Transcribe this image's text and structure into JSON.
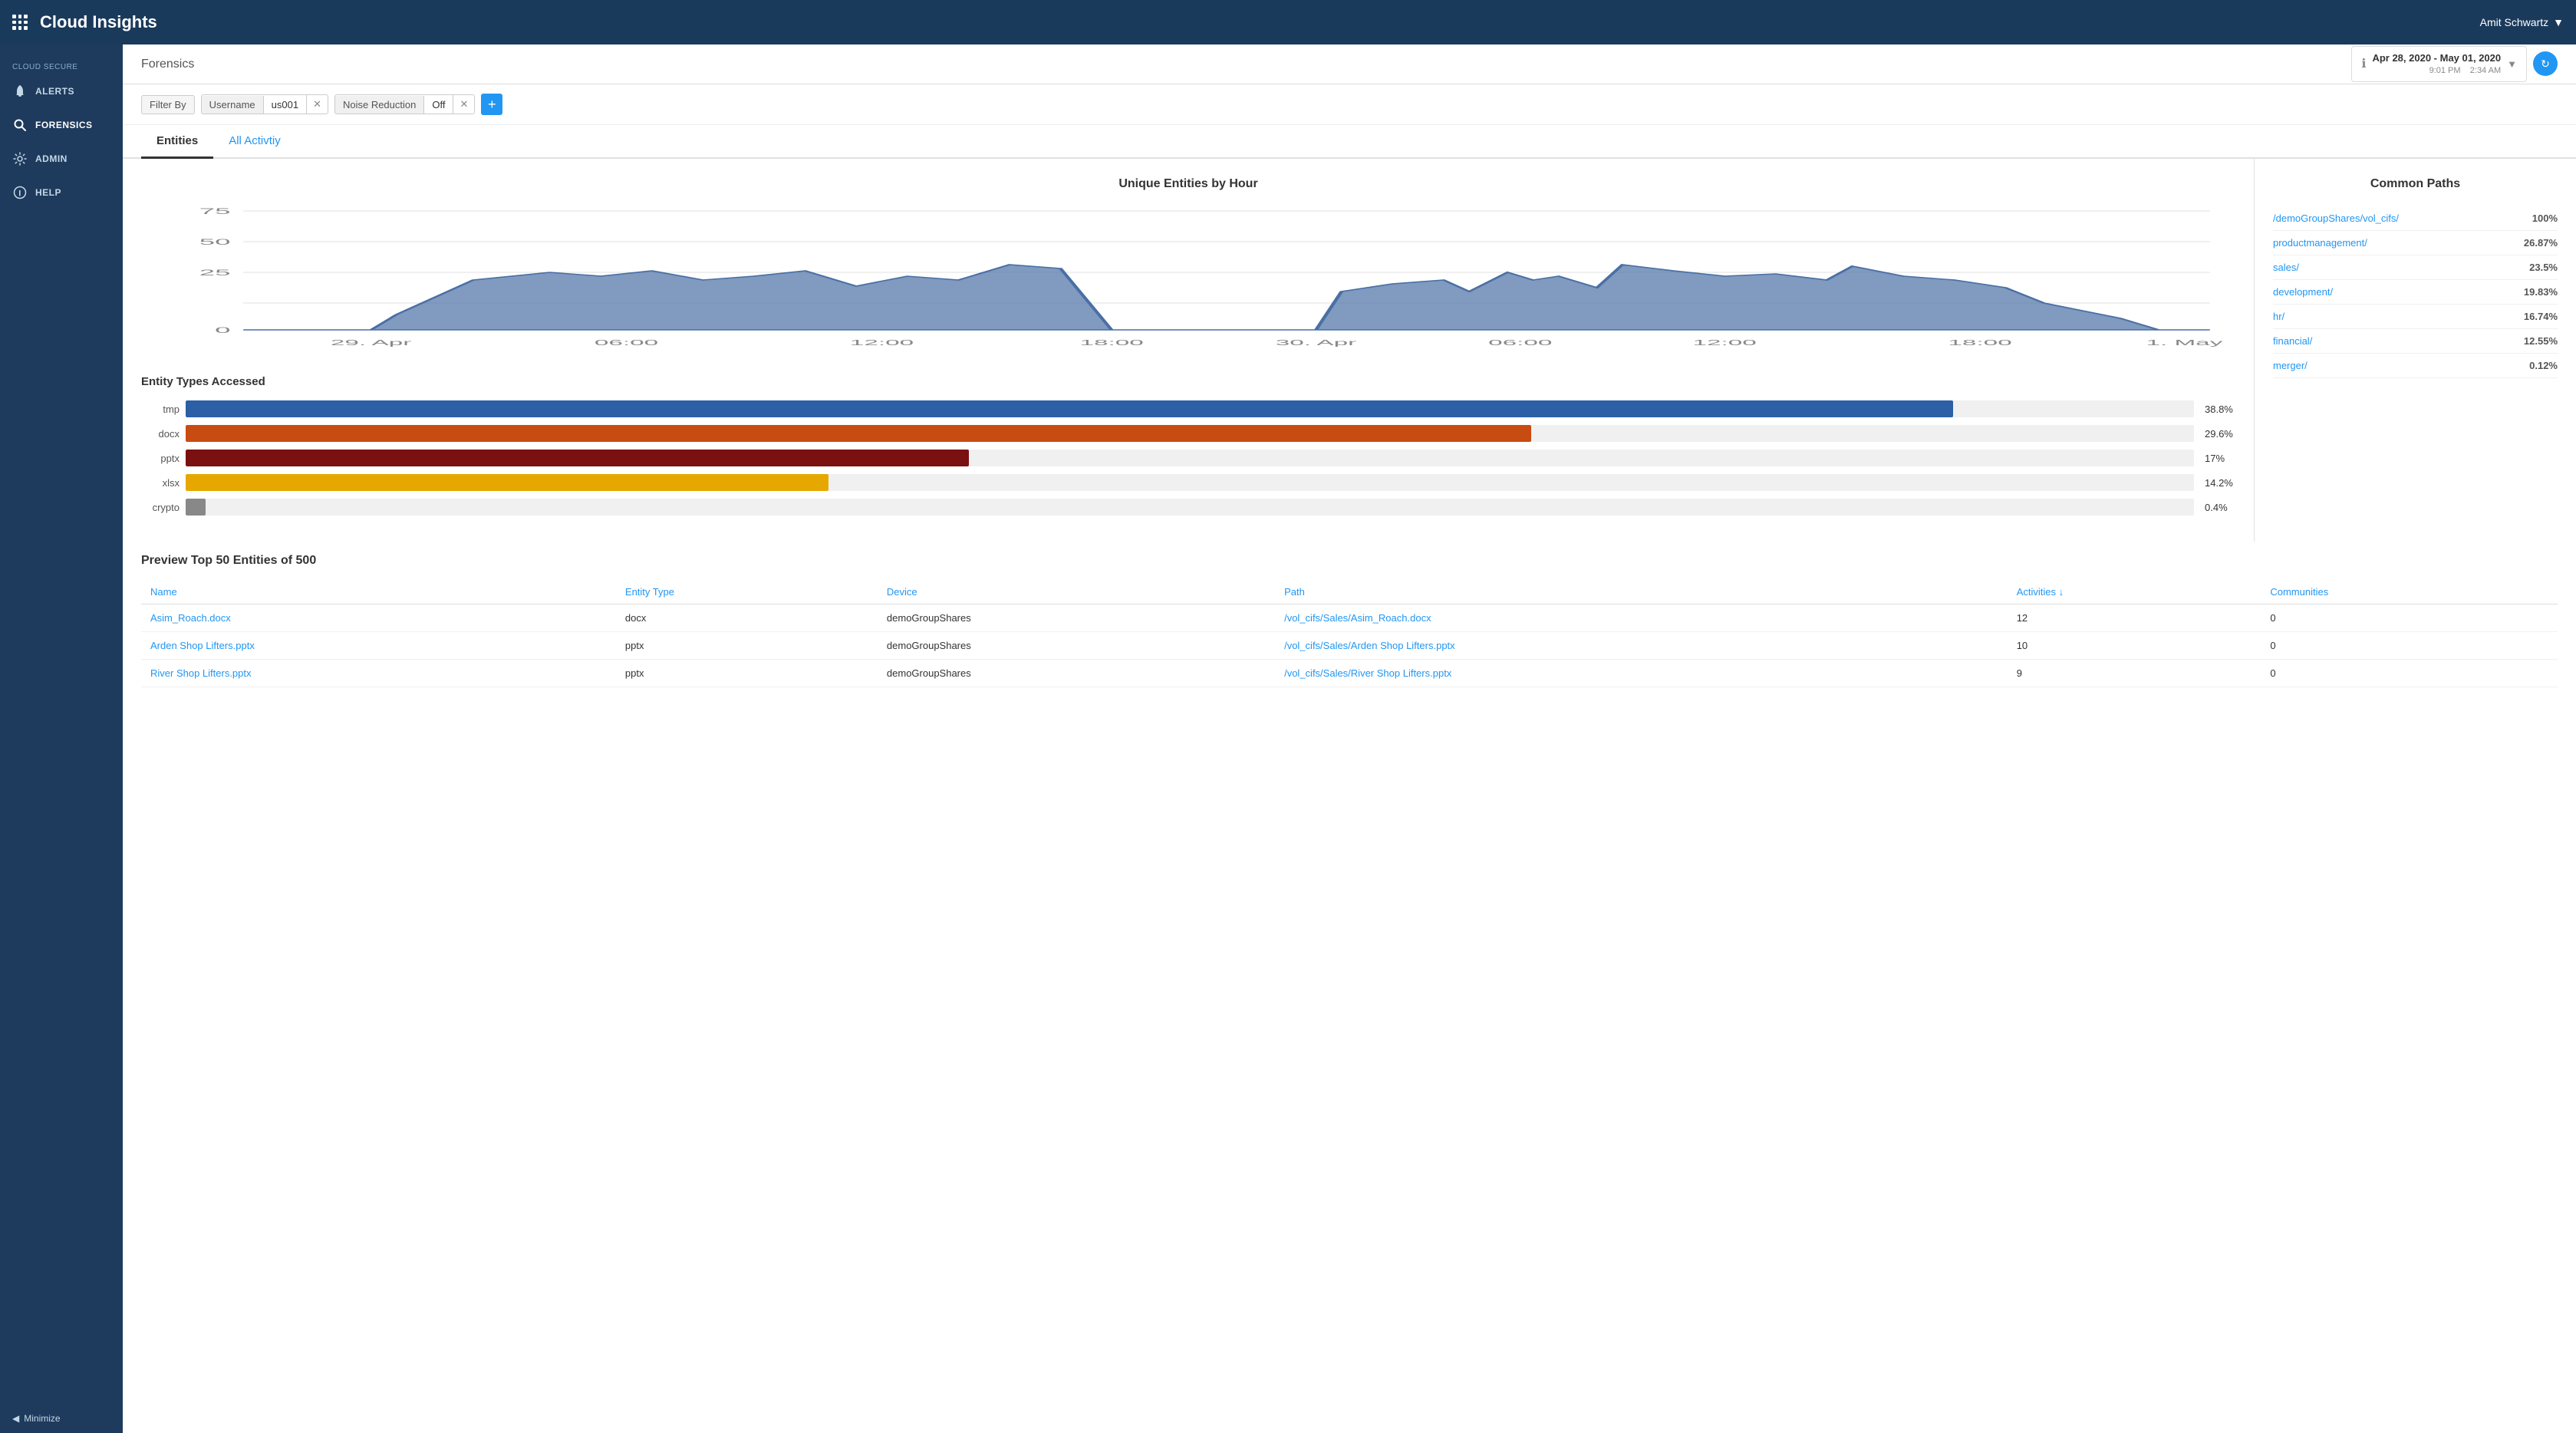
{
  "app": {
    "title": "Cloud Insights",
    "user": "Amit Schwartz"
  },
  "navbar": {
    "grid_icon": "grid",
    "dropdown_arrow": "▼"
  },
  "sidebar": {
    "section_label": "Cloud Secure",
    "items": [
      {
        "id": "alerts",
        "label": "Alerts",
        "icon": "bell"
      },
      {
        "id": "forensics",
        "label": "Forensics",
        "icon": "search",
        "active": true
      },
      {
        "id": "admin",
        "label": "Admin",
        "icon": "gear"
      },
      {
        "id": "help",
        "label": "Help",
        "icon": "info"
      }
    ],
    "minimize_label": "Minimize"
  },
  "sub_header": {
    "title": "Forensics",
    "date_range": {
      "main_date": "Apr 28, 2020 - May 01, 2020",
      "start_time": "9:01 PM",
      "end_time": "2:34 AM"
    }
  },
  "filter_bar": {
    "label": "Filter By",
    "filters": [
      {
        "key": "Username",
        "value": "us001"
      },
      {
        "key": "Noise Reduction",
        "value": "Off"
      }
    ],
    "add_button": "+"
  },
  "tabs": [
    {
      "id": "entities",
      "label": "Entities",
      "active": true
    },
    {
      "id": "all-activity",
      "label": "All Activtiy",
      "link": true
    }
  ],
  "unique_entities_chart": {
    "title": "Unique Entities by Hour",
    "y_labels": [
      "75",
      "50",
      "25",
      "0"
    ],
    "x_labels": [
      "29. Apr",
      "06:00",
      "12:00",
      "18:00",
      "30. Apr",
      "06:00",
      "12:00",
      "18:00",
      "1. May"
    ]
  },
  "entity_types_chart": {
    "title": "Entity Types Accessed",
    "bars": [
      {
        "label": "tmp",
        "value": 38.8,
        "pct": "38.8%",
        "color": "#2b5fa6"
      },
      {
        "label": "docx",
        "value": 29.6,
        "pct": "29.6%",
        "color": "#c84b11"
      },
      {
        "label": "pptx",
        "value": 17,
        "pct": "17%",
        "color": "#7b1010"
      },
      {
        "label": "xlsx",
        "value": 14.2,
        "pct": "14.2%",
        "color": "#e6a800"
      },
      {
        "label": "crypto",
        "value": 0.4,
        "pct": "0.4%",
        "color": "#888"
      }
    ]
  },
  "common_paths": {
    "title": "Common Paths",
    "paths": [
      {
        "name": "/demoGroupShares/vol_cifs/",
        "pct": "100%"
      },
      {
        "name": "productmanagement/",
        "pct": "26.87%"
      },
      {
        "name": "sales/",
        "pct": "23.5%"
      },
      {
        "name": "development/",
        "pct": "19.83%"
      },
      {
        "name": "hr/",
        "pct": "16.74%"
      },
      {
        "name": "financial/",
        "pct": "12.55%"
      },
      {
        "name": "merger/",
        "pct": "0.12%"
      }
    ]
  },
  "preview_table": {
    "title": "Preview Top 50 Entities of 500",
    "columns": [
      "Name",
      "Entity Type",
      "Device",
      "Path",
      "Activities ↓",
      "Communities"
    ],
    "rows": [
      {
        "name": "Asim_Roach.docx",
        "entity_type": "docx",
        "device": "demoGroupShares",
        "path": "/vol_cifs/Sales/Asim_Roach.docx",
        "activities": "12",
        "communities": "0"
      },
      {
        "name": "Arden Shop Lifters.pptx",
        "entity_type": "pptx",
        "device": "demoGroupShares",
        "path": "/vol_cifs/Sales/Arden Shop Lifters.pptx",
        "activities": "10",
        "communities": "0"
      },
      {
        "name": "River Shop Lifters.pptx",
        "entity_type": "pptx",
        "device": "demoGroupShares",
        "path": "/vol_cifs/Sales/River Shop Lifters.pptx",
        "activities": "9",
        "communities": "0"
      }
    ]
  }
}
